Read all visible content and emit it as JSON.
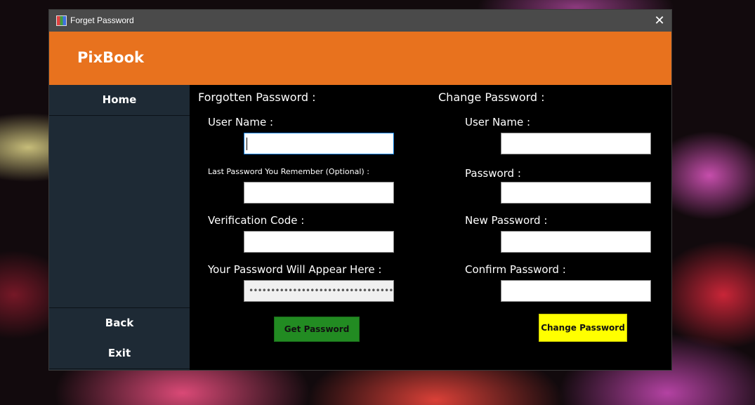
{
  "window": {
    "title": "Forget Password",
    "icon": "app-icon"
  },
  "header": {
    "brand": "PixBook",
    "color": "#E8721E"
  },
  "sidebar": {
    "home_label": "Home",
    "back_label": "Back",
    "exit_label": "Exit"
  },
  "forgot": {
    "section_title": "Forgotten Password :",
    "username_label": "User Name :",
    "username_value": "",
    "last_password_label": "Last Password You Remember (Optional) :",
    "last_password_value": "",
    "verification_label": "Verification Code  :",
    "verification_value": "",
    "result_label": "Your Password Will Appear Here  :",
    "result_value": "••••••••••••••••••••••••••••••••••••••••",
    "button_label": "Get Password",
    "button_color": "#228B22"
  },
  "change": {
    "section_title": "Change Password :",
    "username_label": "User Name :",
    "username_value": "",
    "password_label": "Password :",
    "password_value": "",
    "new_password_label": "New Password  :",
    "new_password_value": "",
    "confirm_password_label": "Confirm Password  :",
    "confirm_password_value": "",
    "button_label": "Change Password",
    "button_color": "#FFFF00"
  }
}
